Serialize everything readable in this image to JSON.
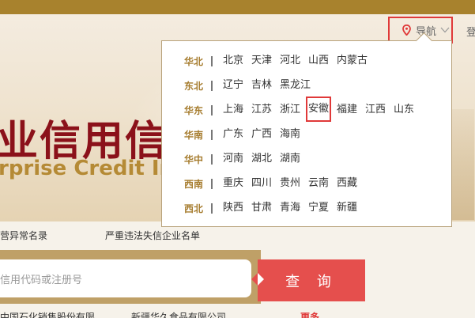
{
  "header": {
    "nav_label": "导航",
    "login_label": "登"
  },
  "banner": {
    "title_cn": "业信用信",
    "title_en": "rprise Credit Info"
  },
  "region_dropdown": {
    "regions": [
      {
        "name": "华北",
        "provinces": [
          "北京",
          "天津",
          "河北",
          "山西",
          "内蒙古"
        ]
      },
      {
        "name": "东北",
        "provinces": [
          "辽宁",
          "吉林",
          "黑龙江"
        ]
      },
      {
        "name": "华东",
        "provinces": [
          "上海",
          "江苏",
          "浙江",
          "安徽",
          "福建",
          "江西",
          "山东"
        ]
      },
      {
        "name": "华南",
        "provinces": [
          "广东",
          "广西",
          "海南"
        ]
      },
      {
        "name": "华中",
        "provinces": [
          "河南",
          "湖北",
          "湖南"
        ]
      },
      {
        "name": "西南",
        "provinces": [
          "重庆",
          "四川",
          "贵州",
          "云南",
          "西藏"
        ]
      },
      {
        "name": "西北",
        "provinces": [
          "陕西",
          "甘肃",
          "青海",
          "宁夏",
          "新疆"
        ]
      }
    ],
    "highlighted": "安徽"
  },
  "links": {
    "abnormal_list": "营异常名录",
    "serious_violation_list": "严重违法失信企业名单"
  },
  "search": {
    "placeholder": "信用代码或注册号",
    "button_label": "查 询"
  },
  "recent": {
    "item1": "中国石化销售股份有限",
    "item2": "新疆华久食品有限公司",
    "more": "更多"
  },
  "colors": {
    "accent_gold": "#a8822d",
    "brand_red": "#e54f4d",
    "highlight_red": "#e03939",
    "title_red": "#8b111a"
  }
}
